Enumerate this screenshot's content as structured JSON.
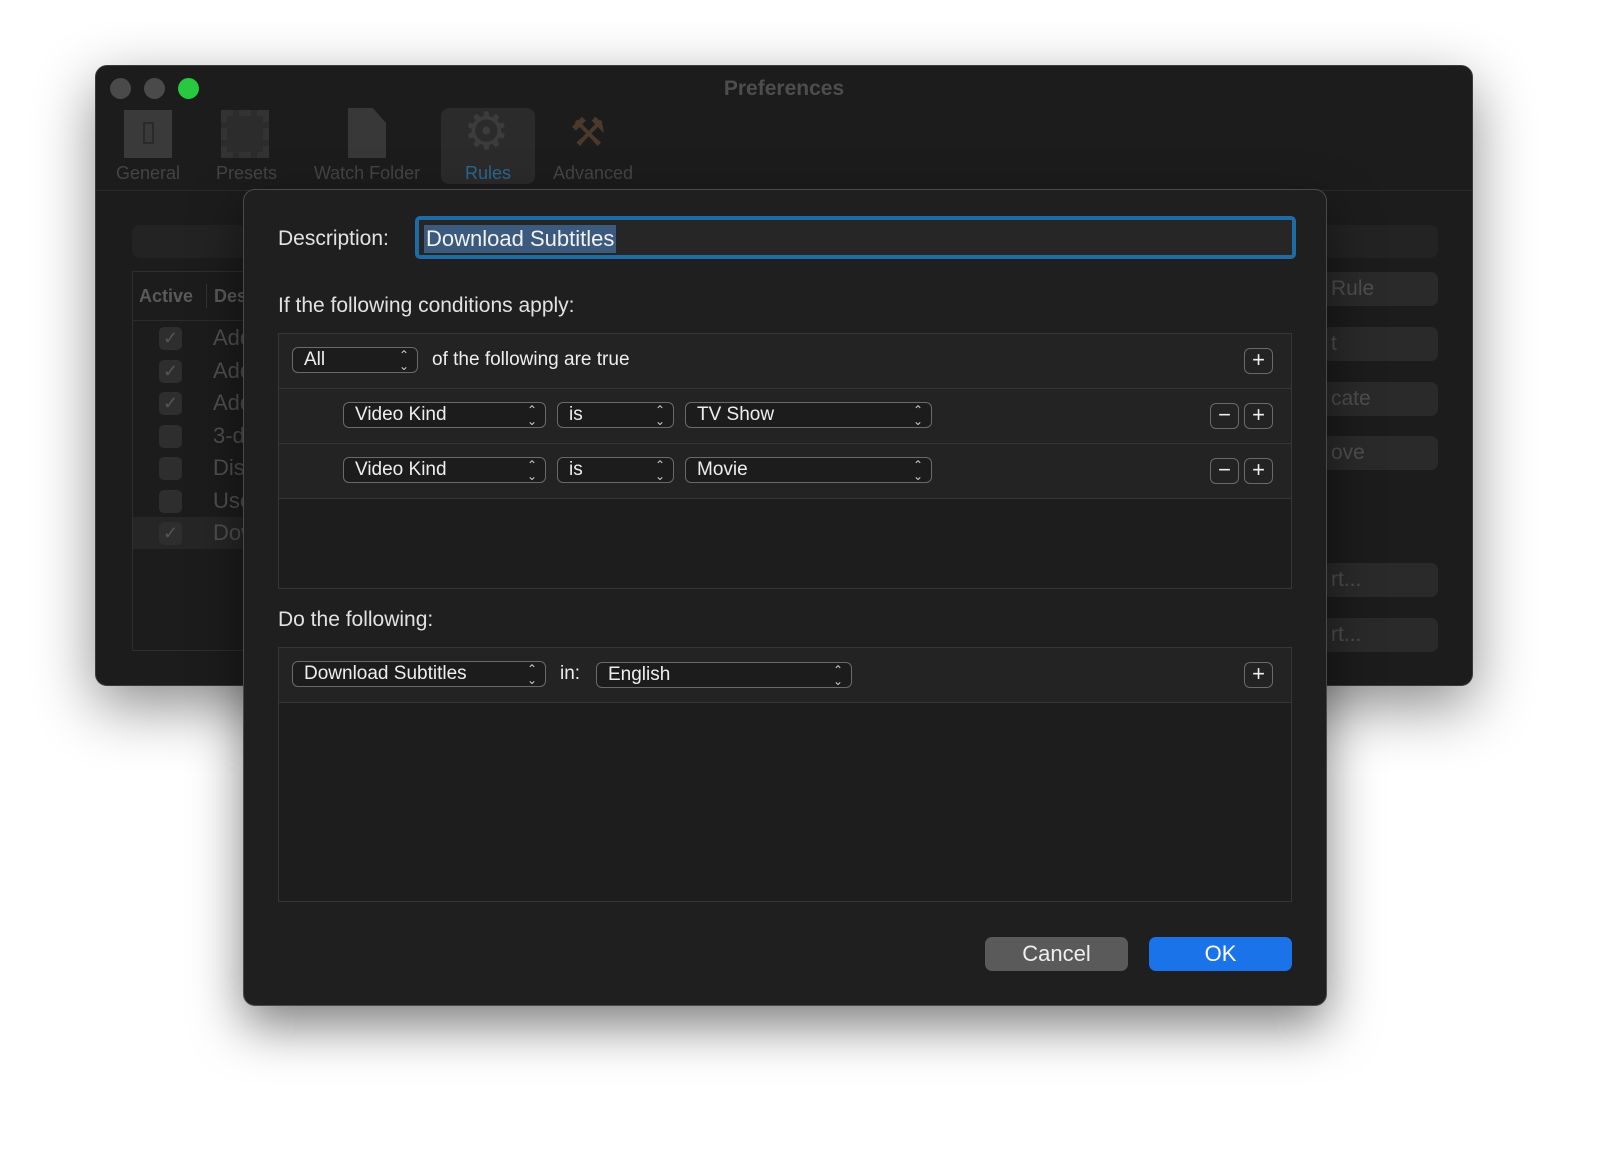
{
  "window": {
    "title": "Preferences",
    "traffic_lights": {
      "close": "#4a4a4a",
      "minimize": "#4a4a4a",
      "zoom": "#28c840"
    }
  },
  "toolbar": {
    "items": [
      {
        "label": "General",
        "icon": "switch-icon"
      },
      {
        "label": "Presets",
        "icon": "film-icon"
      },
      {
        "label": "Watch Folder",
        "icon": "document-icon"
      },
      {
        "label": "Rules",
        "icon": "gear-icon",
        "selected": true
      },
      {
        "label": "Advanced",
        "icon": "hammer-wrench-icon"
      }
    ]
  },
  "background": {
    "table": {
      "headers": [
        "Active",
        "Des"
      ],
      "rows": [
        {
          "active": true,
          "text": "Add"
        },
        {
          "active": true,
          "text": "Add"
        },
        {
          "active": true,
          "text": "Add"
        },
        {
          "active": false,
          "text": "3-d"
        },
        {
          "active": false,
          "text": "Dis"
        },
        {
          "active": false,
          "text": "Use"
        },
        {
          "active": true,
          "text": "Dow",
          "selected": true
        }
      ]
    },
    "buttons": [
      "Rule",
      "t",
      "cate",
      "ove",
      "rt...",
      "rt..."
    ]
  },
  "sheet": {
    "description_label": "Description:",
    "description_value": "Download Subtitles",
    "conditions_heading": "If the following conditions apply:",
    "match_mode": "All",
    "match_suffix": "of the following are true",
    "conditions": [
      {
        "field": "Video Kind",
        "operator": "is",
        "value": "TV Show"
      },
      {
        "field": "Video Kind",
        "operator": "is",
        "value": "Movie"
      }
    ],
    "actions_heading": "Do the following:",
    "actions": [
      {
        "action": "Download Subtitles",
        "in_label": "in:",
        "language": "English"
      }
    ],
    "cancel_label": "Cancel",
    "ok_label": "OK",
    "accent": "#1a73e8"
  }
}
